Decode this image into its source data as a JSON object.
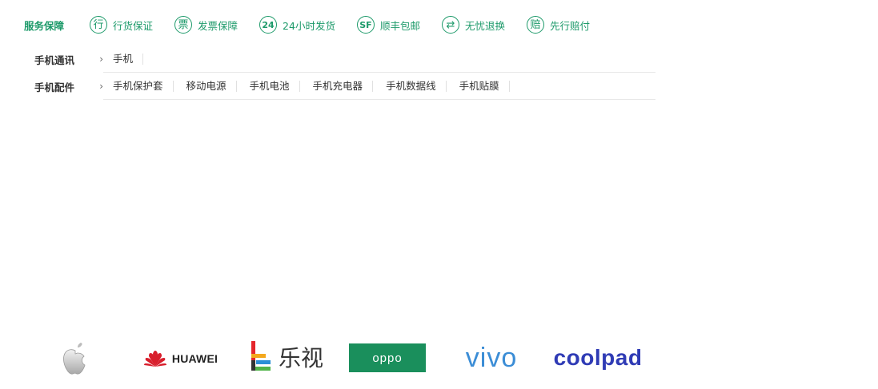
{
  "service_bar": {
    "title": "服务保障",
    "items": [
      {
        "icon": "行",
        "icon_name": "genuine-icon",
        "label": "行货保证"
      },
      {
        "icon": "票",
        "icon_name": "invoice-icon",
        "label": "发票保障"
      },
      {
        "icon": "24",
        "icon_name": "24h-icon",
        "label": "24小时发货"
      },
      {
        "icon": "SF",
        "icon_name": "sf-express-icon",
        "label": "顺丰包邮"
      },
      {
        "icon": "⇄",
        "icon_name": "exchange-icon",
        "label": "无忧退换"
      },
      {
        "icon": "赔",
        "icon_name": "compensation-icon",
        "label": "先行赔付"
      }
    ],
    "accent_color": "#1d9a6a"
  },
  "categories": [
    {
      "name": "手机通讯",
      "links": [
        "手机"
      ]
    },
    {
      "name": "手机配件",
      "links": [
        "手机保护套",
        "移动电源",
        "手机电池",
        "手机充电器",
        "手机数据线",
        "手机贴膜"
      ]
    }
  ],
  "brands": {
    "huawei": "HUAWEI",
    "letv": "乐视",
    "oppo": "oppo",
    "vivo": "vivo",
    "coolpad": "coolpad"
  }
}
